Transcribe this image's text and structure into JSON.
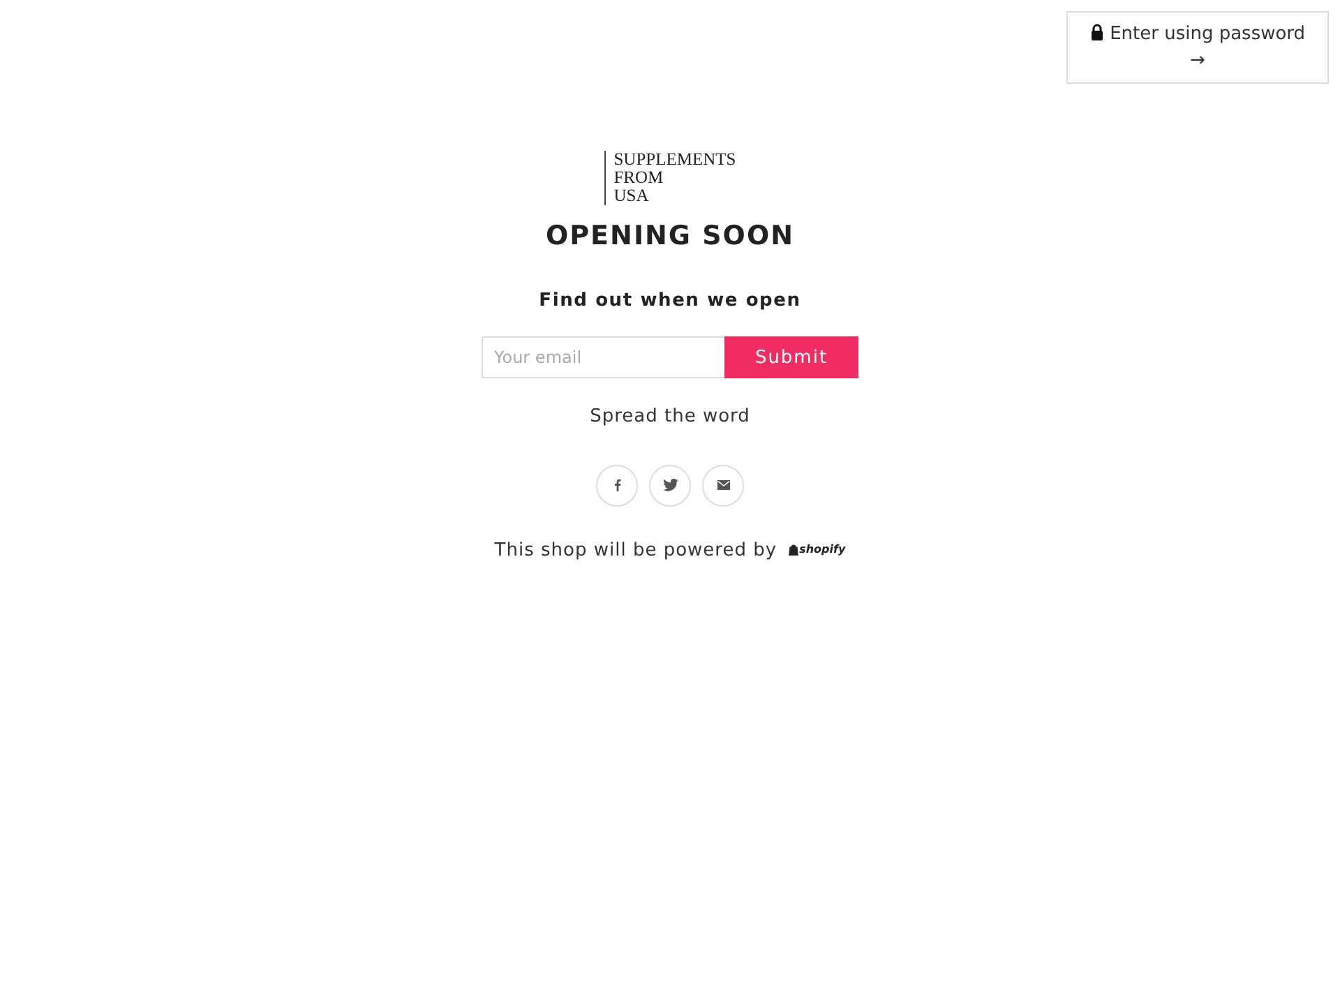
{
  "password_link": {
    "label": "Enter using password",
    "arrow": "→"
  },
  "logo": {
    "lines": [
      "SUPPLEMENTS",
      "FROM",
      "USA"
    ]
  },
  "heading": "OPENING SOON",
  "signup": {
    "title": "Find out when we open",
    "placeholder": "Your email",
    "button": "Submit"
  },
  "share": {
    "title": "Spread the word",
    "buttons": [
      {
        "kind": "facebook"
      },
      {
        "kind": "twitter"
      },
      {
        "kind": "email"
      }
    ]
  },
  "footer": {
    "text": "This shop will be powered by",
    "brand": "shopify"
  }
}
